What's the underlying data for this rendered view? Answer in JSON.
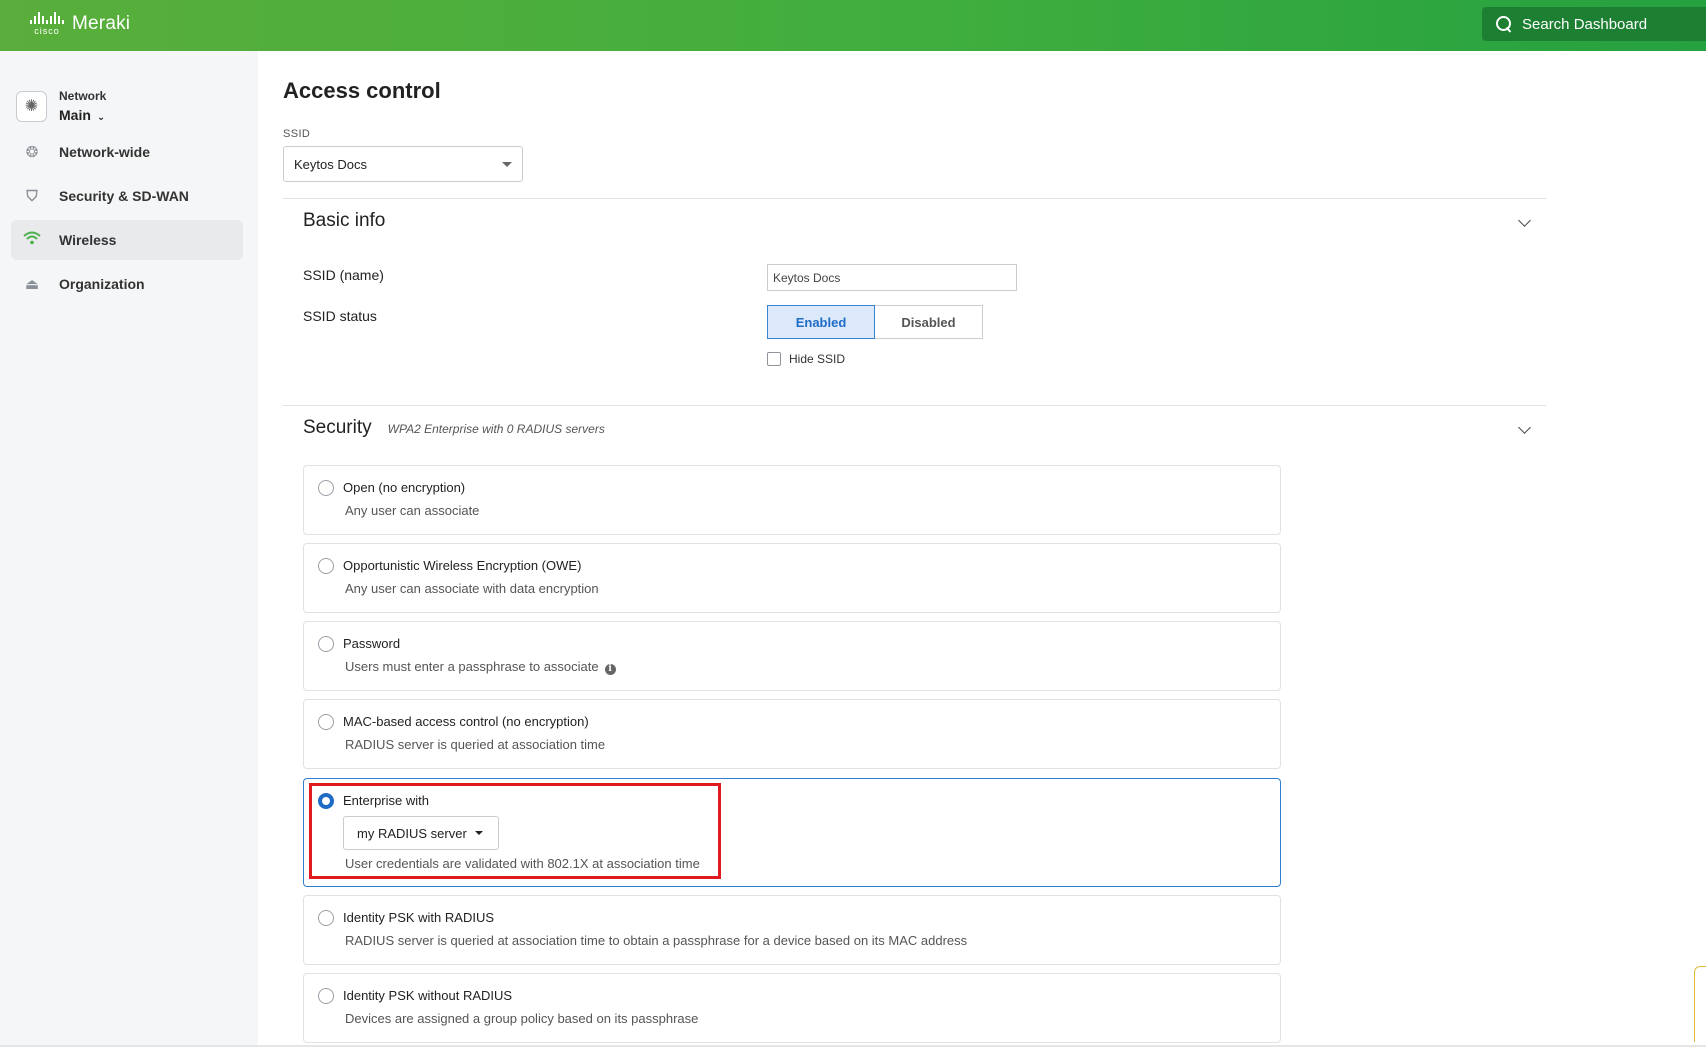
{
  "header": {
    "brand_cisco": "cisco",
    "brand_product": "Meraki",
    "search_label": "Search Dashboard"
  },
  "sidebar": {
    "network_label": "Network",
    "network_name": "Main",
    "items": [
      {
        "label": "Network-wide",
        "icon": "network-wide-icon"
      },
      {
        "label": "Security & SD-WAN",
        "icon": "shield-icon"
      },
      {
        "label": "Wireless",
        "icon": "wifi-icon",
        "active": true
      },
      {
        "label": "Organization",
        "icon": "organization-icon"
      }
    ]
  },
  "main": {
    "title": "Access control",
    "ssid_label": "SSID",
    "ssid_selected": "Keytos Docs",
    "basic_info": {
      "title": "Basic info",
      "ssid_name_label": "SSID (name)",
      "ssid_name_value": "Keytos Docs",
      "ssid_status_label": "SSID status",
      "enabled_label": "Enabled",
      "disabled_label": "Disabled",
      "hide_ssid_label": "Hide SSID"
    },
    "security": {
      "title": "Security",
      "subtitle": "WPA2 Enterprise with 0 RADIUS servers",
      "options": [
        {
          "title": "Open (no encryption)",
          "desc": "Any user can associate"
        },
        {
          "title": "Opportunistic Wireless Encryption (OWE)",
          "desc": "Any user can associate with data encryption"
        },
        {
          "title": "Password",
          "desc": "Users must enter a passphrase to associate"
        },
        {
          "title": "MAC-based access control (no encryption)",
          "desc": "RADIUS server is queried at association time"
        },
        {
          "title": "Enterprise with",
          "desc": "User credentials are validated with 802.1X at association time",
          "dropdown": "my RADIUS server",
          "selected": true
        },
        {
          "title": "Identity PSK with RADIUS",
          "desc": "RADIUS server is queried at association time to obtain a passphrase for a device based on its MAC address"
        },
        {
          "title": "Identity PSK without RADIUS",
          "desc": "Devices are assigned a group policy based on its passphrase"
        }
      ]
    }
  },
  "colors": {
    "brand_green": "#3fae3e",
    "accent_blue": "#1f6cc6",
    "highlight_red": "#e01b1f"
  }
}
